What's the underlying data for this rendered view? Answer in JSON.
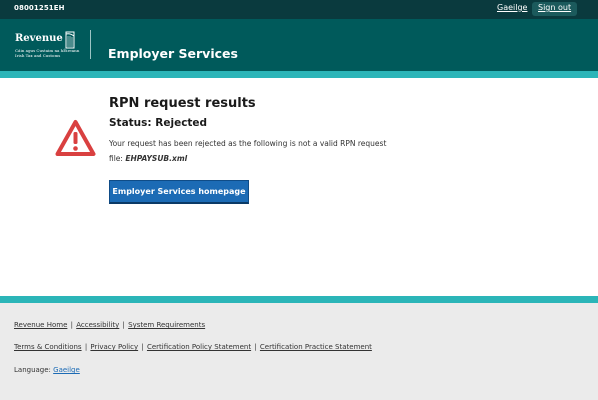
{
  "topbar": {
    "user_id": "08001251EH",
    "language_link": "Gaeilge",
    "sign_out": "Sign out"
  },
  "header": {
    "logo": {
      "brand": "Revenue",
      "line1": "Cáin agus Custaim na hÉireann",
      "line2": "Irish Tax and Customs"
    },
    "service_title": "Employer Services"
  },
  "main": {
    "heading": "RPN request results",
    "status": "Status: Rejected",
    "message": "Your request has been rejected as the following is not a valid RPN request",
    "file_label": "file:",
    "file_name": "EHPAYSUB.xml",
    "home_button": "Employer Services homepage",
    "icon": "warning-triangle-icon"
  },
  "footer": {
    "links_row1": [
      "Revenue Home",
      "Accessibility",
      "System Requirements"
    ],
    "links_row2": [
      "Terms & Conditions",
      "Privacy Policy",
      "Certification Policy Statement",
      "Certification Practice Statement"
    ],
    "language_label": "Language:",
    "language_value": "Gaeilge",
    "separator": "|"
  },
  "colors": {
    "topbar": "#0a3a3e",
    "header": "#005a5b",
    "accent_stripe": "#2bb5b8",
    "button": "#1c6bb5",
    "warning": "#d94040",
    "footer_bg": "#ebebeb"
  }
}
